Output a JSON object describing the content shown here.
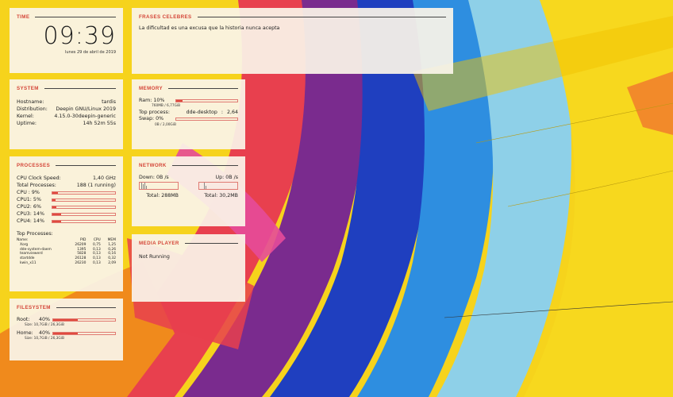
{
  "time": {
    "title": "TIME",
    "clock": "09:39",
    "date": "lunes 29 de abril de 2019"
  },
  "quotes": {
    "title": "FRASES CELEBRES",
    "text": "La dificultad es una excusa que la historia nunca acepta"
  },
  "system": {
    "title": "SYSTEM",
    "rows": [
      {
        "label": "Hostname:",
        "value": "tardis"
      },
      {
        "label": "Distribution:",
        "value": "Deepin GNU/Linux 2019"
      },
      {
        "label": "Kernel:",
        "value": "4.15.0-30deepin-generic"
      },
      {
        "label": "Uptime:",
        "value": "14h 52m 55s"
      }
    ]
  },
  "memory": {
    "title": "MEMORY",
    "ram_label": "Ram: 10%",
    "ram_level": 0.1,
    "ram_detail": "760MB / 6,77GiB",
    "top_label": "Top process:",
    "top_name": "dde-desktop",
    "top_sep": ":",
    "top_value": "2,64",
    "swap_label": "Swap: 0%",
    "swap_level": 0.0,
    "swap_detail": "0B / 2,00GiB"
  },
  "processes": {
    "title": "PROCESSES",
    "cpu_speed_label": "CPU Clock Speed:",
    "cpu_speed_value": "1,40 GHz",
    "total_label": "Total Processes:",
    "total_value": "188 (1 running)",
    "cpus": [
      {
        "label": "CPU : 9%",
        "level": 0.09
      },
      {
        "label": "CPU1: 5%",
        "level": 0.05
      },
      {
        "label": "CPU2: 6%",
        "level": 0.06
      },
      {
        "label": "CPU3: 14%",
        "level": 0.14
      },
      {
        "label": "CPU4: 14%",
        "level": 0.14
      }
    ],
    "top_title": "Top Processes:",
    "columns": [
      "Name:",
      "PID",
      "CPU",
      "MEM"
    ],
    "rows": [
      [
        "Xorg",
        "26209",
        "0,75",
        "1,25"
      ],
      [
        "dde-system-daem",
        "1395",
        "0,13",
        "0,26"
      ],
      [
        "teamviewerd",
        "5828",
        "0,13",
        "0,16"
      ],
      [
        "startdde",
        "26128",
        "0,13",
        "0,32"
      ],
      [
        "kwin_x11",
        "26230",
        "0,13",
        "2,09"
      ]
    ]
  },
  "network": {
    "title": "NETWORK",
    "down_label": "Down: 0B",
    "down_unit": "/s",
    "up_label": "Up: 0B",
    "up_unit": "/s",
    "total_down": "Total: 288MB",
    "total_up": "Total: 30,2MB"
  },
  "filesystem": {
    "title": "FILESYSTEM",
    "items": [
      {
        "label": "Root:",
        "percent": "40%",
        "level": 0.4,
        "size": "Size: 10,7GiB / 26,3GiB"
      },
      {
        "label": "Home:",
        "percent": "40%",
        "level": 0.4,
        "size": "Size: 10,7GiB / 26,3GiB"
      }
    ]
  },
  "media": {
    "title": "MEDIA PLAYER",
    "status": "Not Running"
  }
}
